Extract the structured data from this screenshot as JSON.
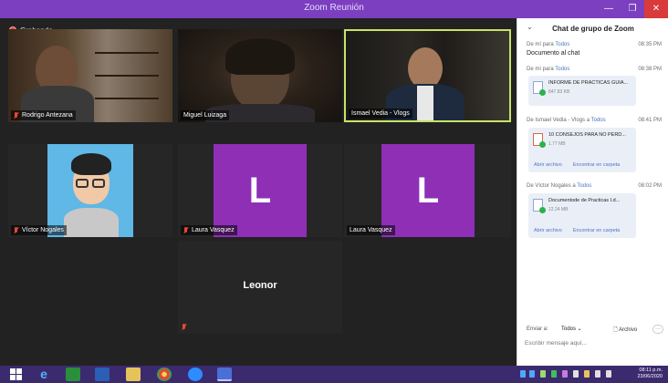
{
  "window": {
    "title": "Zoom Reunión",
    "min_glyph": "—",
    "max_glyph": "❐",
    "close_glyph": "✕"
  },
  "recording": {
    "label": "Grabando"
  },
  "participants": [
    {
      "name": "Rodrigo Antezana"
    },
    {
      "name": "Miguel Luizaga"
    },
    {
      "name": "Ismael Vedia - Vlogs"
    },
    {
      "name": "Víctor Nogales"
    },
    {
      "name": "Laura Vasquez",
      "initial": "L"
    },
    {
      "name": "Laura Vasquez",
      "initial": "L"
    },
    {
      "name": "Leonor"
    }
  ],
  "chat": {
    "chevron": "⌄",
    "title": "Chat de grupo de Zoom",
    "messages": [
      {
        "from": "De mí para",
        "to": "Todos",
        "time": "08:35 PM",
        "text": "Documento al chat"
      },
      {
        "from": "De mí para",
        "to": "Todos",
        "time": "08:38 PM",
        "file_name": "INFORME DE PRACTICAS GUIA...",
        "file_size": "847.83 KB"
      },
      {
        "from": "De Ismael Vedia - Vlogs a",
        "to": "Todos",
        "time": "08:41 PM",
        "file_name": "10 CONSEJOS PARA NO PERD...",
        "file_size": "1.77 MB",
        "action_open": "Abrir archivo",
        "action_folder": "Encontrar en carpeta"
      },
      {
        "from": "De Víctor Nogales a",
        "to": "Todos",
        "time": "08:02 PM",
        "file_name": "Documentode de Practicas I.d...",
        "file_size": "12.24 MB",
        "action_open": "Abrir archivo",
        "action_folder": "Encontrar en carpeta"
      }
    ],
    "send_to_label": "Enviar a:",
    "send_to_value": "Todos ⌄",
    "file_button": "Archivo",
    "more_button": "···",
    "input_placeholder": "Escribir mensaje aquí..."
  },
  "taskbar": {
    "clock_time": "08:11 p.m.",
    "clock_date": "23/06/2020",
    "colors": {
      "accent": "#7b3fbf",
      "taskbar": "#3c2a6e"
    }
  }
}
